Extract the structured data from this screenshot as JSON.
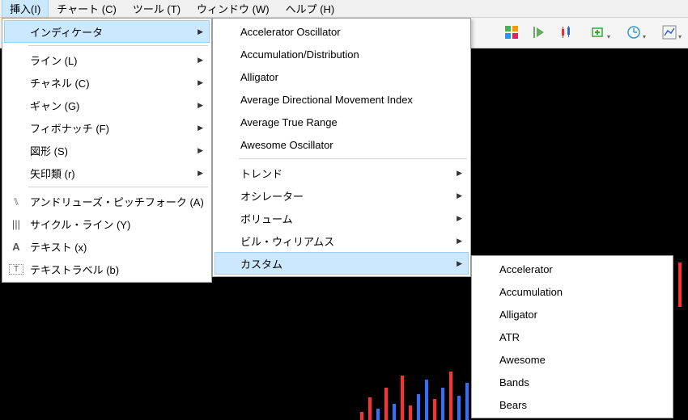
{
  "menubar": {
    "insert": "挿入(I)",
    "chart": "チャート (C)",
    "tool": "ツール (T)",
    "window": "ウィンドウ (W)",
    "help": "ヘルプ (H)"
  },
  "menu1": {
    "indicator": "インディケータ",
    "line": "ライン (L)",
    "channel": "チャネル (C)",
    "gann": "ギャン (G)",
    "fibonacci": "フィボナッチ (F)",
    "shapes": "図形 (S)",
    "arrows": "矢印類 (r)",
    "andrews": "アンドリューズ・ピッチフォーク (A)",
    "cycle": "サイクル・ライン (Y)",
    "text": "テキスト (x)",
    "textlabel": "テキストラベル (b)"
  },
  "menu2": {
    "accel": "Accelerator Oscillator",
    "accum": "Accumulation/Distribution",
    "alligator": "Alligator",
    "adx": "Average Directional Movement Index",
    "atr": "Average True Range",
    "awesome": "Awesome Oscillator",
    "trend": "トレンド",
    "oscillator": "オシレーター",
    "volume": "ボリューム",
    "billwilliams": "ビル・ウィリアムス",
    "custom": "カスタム"
  },
  "menu3": {
    "accel": "Accelerator",
    "accum": "Accumulation",
    "alligator": "Alligator",
    "atr": "ATR",
    "awesome": "Awesome",
    "bands": "Bands",
    "bears": "Bears"
  },
  "icons": {
    "pitchfork": "⑊",
    "cycle": "|||",
    "text": "A",
    "textlabel": "T"
  }
}
